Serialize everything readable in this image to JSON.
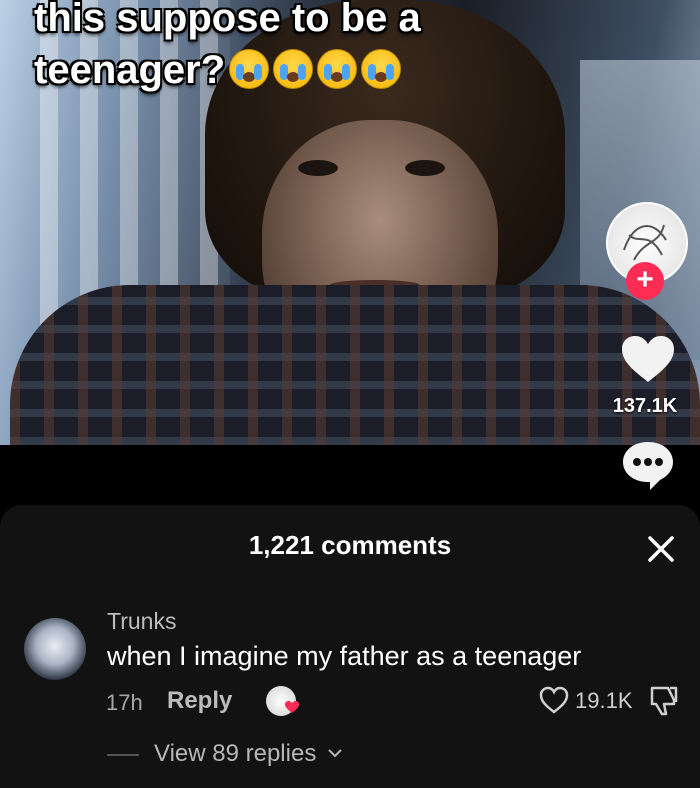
{
  "video": {
    "caption_line1": "this suppose to be a",
    "caption_line2": "teenager?",
    "caption_emojis": [
      "loudly-crying-face",
      "loudly-crying-face",
      "loudly-crying-face",
      "loudly-crying-face"
    ],
    "like_count": "137.1K"
  },
  "comments_sheet": {
    "title": "1,221 comments",
    "comment": {
      "username": "Trunks",
      "text": "when I imagine my father as a teenager",
      "time": "17h",
      "reply_label": "Reply",
      "like_count": "19.1K",
      "view_replies": "View 89 replies"
    }
  },
  "colors": {
    "accent": "#fe2c55",
    "sheet_bg": "#121212"
  }
}
